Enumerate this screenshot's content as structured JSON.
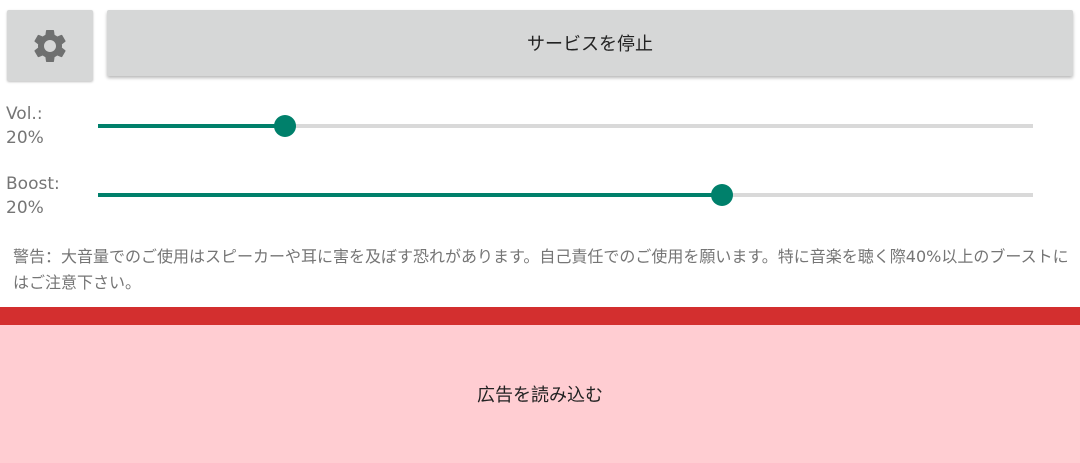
{
  "header": {
    "settings_icon": "gear-icon",
    "stop_service_label": "サービスを停止"
  },
  "sliders": {
    "volume": {
      "label_line1": "Vol.:",
      "label_line2": "20%",
      "level_fraction": 0.2
    },
    "boost": {
      "label_line1": "Boost:",
      "label_line2": "20%",
      "level_fraction": 0.667
    }
  },
  "warning": {
    "text": "警告：大音量でのご使用はスピーカーや耳に害を及ぼす恐れがあります。自己責任でのご使用を願います。特に音楽を聴く際40%以上のブーストにはご注意下さい。"
  },
  "ad": {
    "load_label": "広告を読み込む"
  },
  "colors": {
    "accent": "#00806b",
    "track": "#d9d9d9",
    "button_bg": "#d6d7d7",
    "ad_bar": "#d32f2f",
    "ad_bg": "#ffcdd2"
  }
}
